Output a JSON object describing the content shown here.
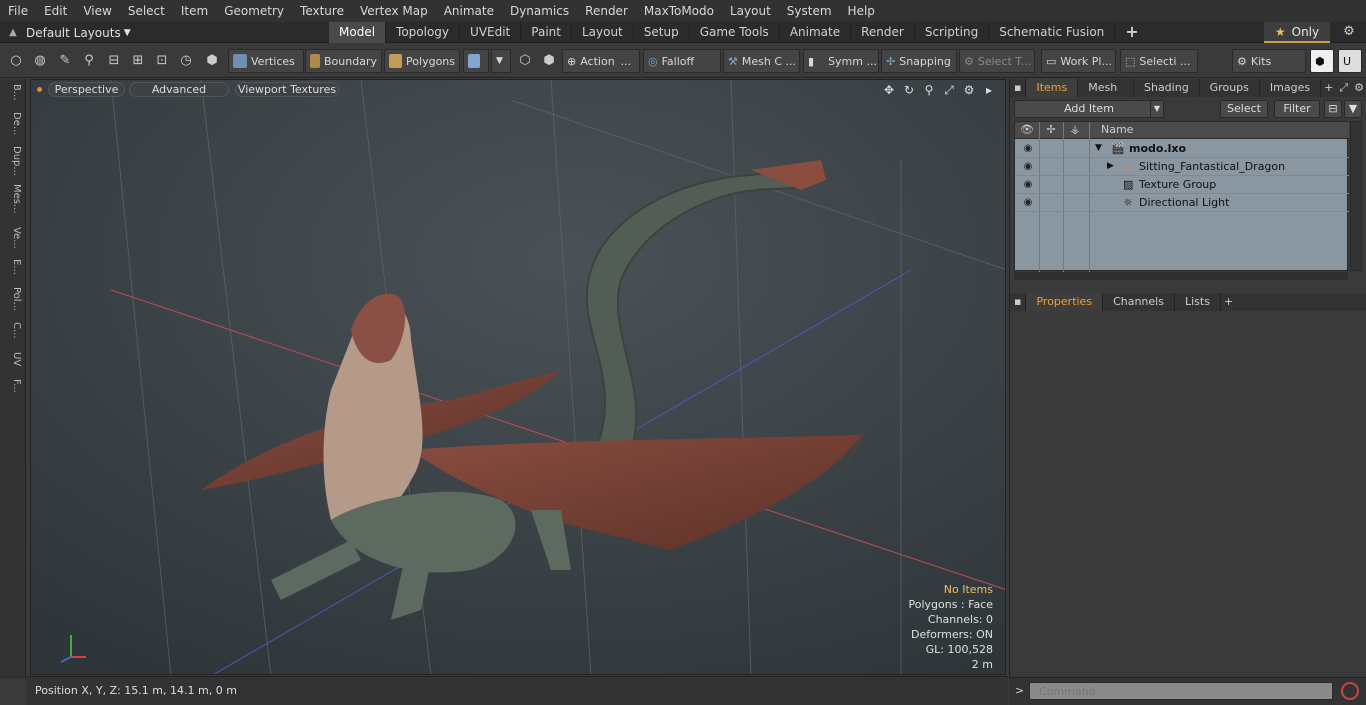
{
  "menu": [
    "File",
    "Edit",
    "View",
    "Select",
    "Item",
    "Geometry",
    "Texture",
    "Vertex Map",
    "Animate",
    "Dynamics",
    "Render",
    "MaxToModo",
    "Layout",
    "System",
    "Help"
  ],
  "layouts": {
    "label": "Default Layouts"
  },
  "tabs": [
    {
      "label": "Model",
      "active": true
    },
    {
      "label": "Topology"
    },
    {
      "label": "UVEdit"
    },
    {
      "label": "Paint"
    },
    {
      "label": "Layout"
    },
    {
      "label": "Setup"
    },
    {
      "label": "Game Tools"
    },
    {
      "label": "Animate"
    },
    {
      "label": "Render"
    },
    {
      "label": "Scripting"
    },
    {
      "label": "Schematic Fusion"
    },
    {
      "label": "+"
    }
  ],
  "only_label": "Only",
  "toolbar": {
    "vertices": "Vertices",
    "boundary": "Boundary",
    "polygons": "Polygons",
    "action": "Action",
    "falloff": "Falloff",
    "mesh": "Mesh C ...",
    "symm": "Symm ...",
    "snapping": "Snapping",
    "select_t": "Select T...",
    "work_pl": "Work Pl...",
    "selecti": "Selecti ...",
    "kits": "Kits"
  },
  "left_strip": [
    "B...",
    "De...",
    "Dup...",
    "Mes...",
    "Ve...",
    "E...",
    "Pol...",
    "C...",
    "UV",
    "F..."
  ],
  "viewport": {
    "perspective": "Perspective",
    "advanced": "Advanced",
    "textures": "Viewport Textures",
    "info": {
      "no_items": "No Items",
      "polygons": "Polygons : Face",
      "channels": "Channels: 0",
      "deformers": "Deformers: ON",
      "gl": "GL: 100,528",
      "scale": "2 m"
    }
  },
  "status": {
    "position": "Position X, Y, Z:   15.1 m, 14.1 m, 0 m"
  },
  "right_panel": {
    "tabs": [
      "Items",
      "Mesh ...",
      "Shading",
      "Groups",
      "Images"
    ],
    "add_item": "Add Item",
    "select": "Select",
    "filter": "Filter",
    "name_header": "Name",
    "items": [
      {
        "name": "modo.lxo"
      },
      {
        "name": "Sitting_Fantastical_Dragon"
      },
      {
        "name": "Texture Group"
      },
      {
        "name": "Directional Light"
      }
    ],
    "lower_tabs": [
      "Properties",
      "Channels",
      "Lists"
    ]
  },
  "command": {
    "placeholder": "Command"
  },
  "colors": {
    "accent": "#e8a23a",
    "star": "#e8c25a",
    "dragon_wing": "#7a4438",
    "dragon_body": "#4f5a52"
  }
}
